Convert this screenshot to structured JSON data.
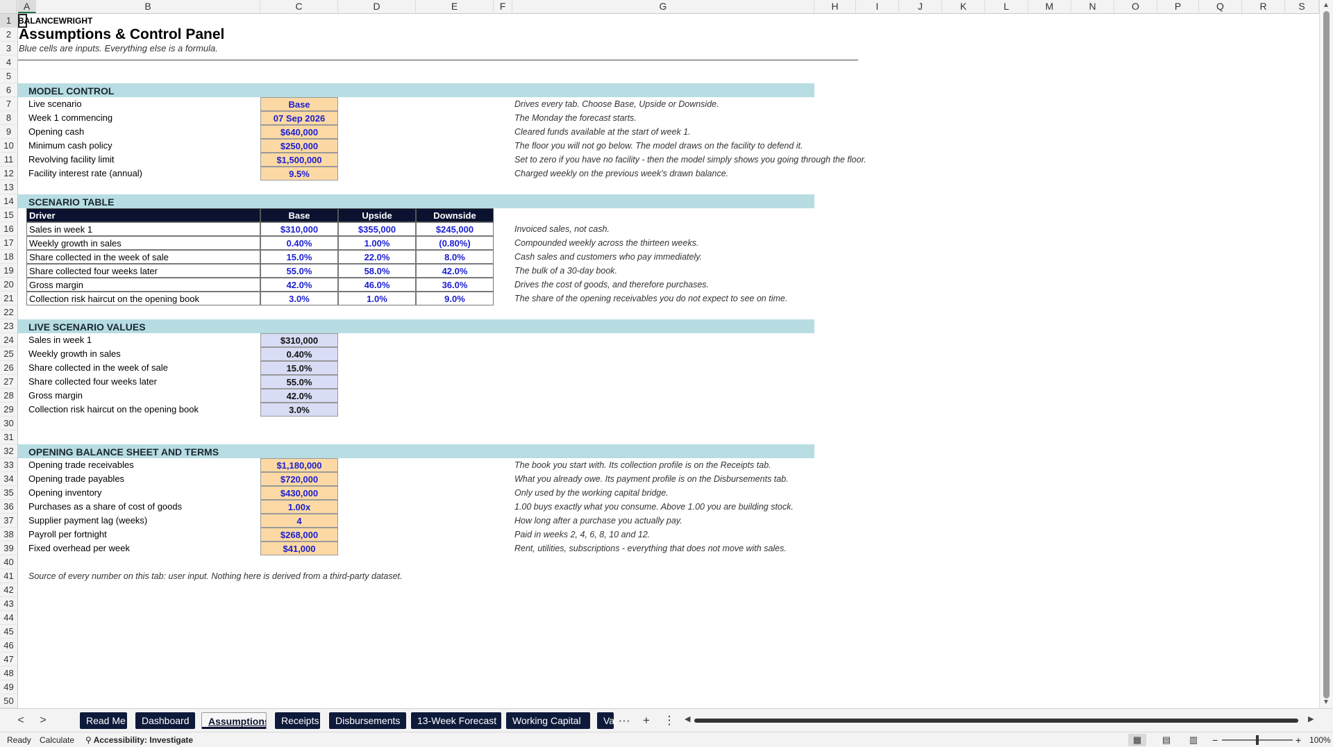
{
  "columns": [
    "A",
    "B",
    "C",
    "D",
    "E",
    "F",
    "G",
    "H",
    "I",
    "J",
    "K",
    "L",
    "M",
    "N",
    "O",
    "P",
    "Q",
    "R",
    "S"
  ],
  "row_numbers": [
    "1",
    "2",
    "3",
    "4",
    "5",
    "6",
    "7",
    "8",
    "9",
    "10",
    "11",
    "12",
    "13",
    "14",
    "15",
    "16",
    "17",
    "18",
    "19",
    "20",
    "21",
    "22",
    "23",
    "24",
    "25",
    "26",
    "27",
    "28",
    "29",
    "30",
    "31",
    "32",
    "33",
    "34",
    "35",
    "36",
    "37",
    "38",
    "39",
    "40",
    "41",
    "42",
    "43",
    "44",
    "45",
    "46",
    "47",
    "48",
    "49",
    "50"
  ],
  "header": {
    "brand": "BALANCEWRIGHT",
    "title": "Assumptions & Control Panel",
    "subtitle": "Blue cells are inputs. Everything else is a formula."
  },
  "model_control": {
    "heading": "MODEL CONTROL",
    "rows": [
      {
        "label": "Live scenario",
        "value": "Base",
        "note": "Drives every tab. Choose Base, Upside or Downside."
      },
      {
        "label": "Week 1 commencing",
        "value": "07 Sep 2026",
        "note": "The Monday the forecast starts."
      },
      {
        "label": "Opening cash",
        "value": "$640,000",
        "note": "Cleared funds available at the start of week 1."
      },
      {
        "label": "Minimum cash policy",
        "value": "$250,000",
        "note": "The floor you will not go below. The model draws on the facility to defend it."
      },
      {
        "label": "Revolving facility limit",
        "value": "$1,500,000",
        "note": "Set to zero if you have no facility - then the model simply shows you going through the floor."
      },
      {
        "label": "Facility interest rate (annual)",
        "value": "9.5%",
        "note": "Charged weekly on the previous week's drawn balance."
      }
    ]
  },
  "scenario_table": {
    "heading": "SCENARIO TABLE",
    "columns": [
      "Driver",
      "Base",
      "Upside",
      "Downside"
    ],
    "rows": [
      {
        "label": "Sales in week 1",
        "base": "$310,000",
        "upside": "$355,000",
        "downside": "$245,000",
        "note": "Invoiced sales, not cash."
      },
      {
        "label": "Weekly growth in sales",
        "base": "0.40%",
        "upside": "1.00%",
        "downside": "(0.80%)",
        "note": "Compounded weekly across the thirteen weeks."
      },
      {
        "label": "Share collected in the week of sale",
        "base": "15.0%",
        "upside": "22.0%",
        "downside": "8.0%",
        "note": "Cash sales and customers who pay immediately."
      },
      {
        "label": "Share collected four weeks later",
        "base": "55.0%",
        "upside": "58.0%",
        "downside": "42.0%",
        "note": "The bulk of a 30-day book."
      },
      {
        "label": "Gross margin",
        "base": "42.0%",
        "upside": "46.0%",
        "downside": "36.0%",
        "note": "Drives the cost of goods, and therefore purchases."
      },
      {
        "label": "Collection risk haircut on the opening book",
        "base": "3.0%",
        "upside": "1.0%",
        "downside": "9.0%",
        "note": "The share of the opening receivables you do not expect to see on time."
      }
    ]
  },
  "live_values": {
    "heading": "LIVE SCENARIO VALUES",
    "rows": [
      {
        "label": "Sales in week 1",
        "value": "$310,000"
      },
      {
        "label": "Weekly growth in sales",
        "value": "0.40%"
      },
      {
        "label": "Share collected in the week of sale",
        "value": "15.0%"
      },
      {
        "label": "Share collected four weeks later",
        "value": "55.0%"
      },
      {
        "label": "Gross margin",
        "value": "42.0%"
      },
      {
        "label": "Collection risk haircut on the opening book",
        "value": "3.0%"
      }
    ]
  },
  "opening_bs": {
    "heading": "OPENING BALANCE SHEET AND TERMS",
    "rows": [
      {
        "label": "Opening trade receivables",
        "value": "$1,180,000",
        "note": "The book you start with. Its collection profile is on the Receipts tab."
      },
      {
        "label": "Opening trade payables",
        "value": "$720,000",
        "note": "What you already owe. Its payment profile is on the Disbursements tab."
      },
      {
        "label": "Opening inventory",
        "value": "$430,000",
        "note": "Only used by the working capital bridge."
      },
      {
        "label": "Purchases as a share of cost of goods",
        "value": "1.00x",
        "note": "1.00 buys exactly what you consume. Above 1.00 you are building stock."
      },
      {
        "label": "Supplier payment lag (weeks)",
        "value": "4",
        "note": "How long after a purchase you actually pay."
      },
      {
        "label": "Payroll per fortnight",
        "value": "$268,000",
        "note": "Paid in weeks 2, 4, 6, 8, 10 and 12."
      },
      {
        "label": "Fixed overhead per week",
        "value": "$41,000",
        "note": "Rent, utilities, subscriptions - everything that does not move with sales."
      }
    ]
  },
  "source_note": "Source of every number on this tab: user input. Nothing here is derived from a third-party dataset.",
  "sheet_tabs": [
    {
      "label": "Read Me",
      "active": false
    },
    {
      "label": "Dashboard",
      "active": false
    },
    {
      "label": "Assumptions",
      "active": true
    },
    {
      "label": "Receipts",
      "active": false
    },
    {
      "label": "Disbursements",
      "active": false
    },
    {
      "label": "13-Week Forecast",
      "active": false
    },
    {
      "label": "Working Capital",
      "active": false
    },
    {
      "label": "Va",
      "active": false
    }
  ],
  "tab_controls": {
    "prev": "<",
    "next": ">",
    "more": "···",
    "add": "+",
    "options": "⋮"
  },
  "statusbar": {
    "ready": "Ready",
    "calculate": "Calculate",
    "accessibility": "Accessibility: Investigate",
    "zoom": "100%",
    "zoom_level": 1.0
  },
  "icons": {
    "accessibility": "accessibility-icon",
    "normal_view": "normal-view-icon",
    "page_layout": "page-layout-view-icon",
    "page_break": "page-break-view-icon"
  },
  "colors": {
    "input_fill": "#fcd9a4",
    "input_text": "#1a1ed1",
    "live_fill": "#d8dcf5",
    "band_fill": "#b7dde2",
    "table_header": "#0b1230",
    "tab_fill": "#0e1a3a"
  }
}
